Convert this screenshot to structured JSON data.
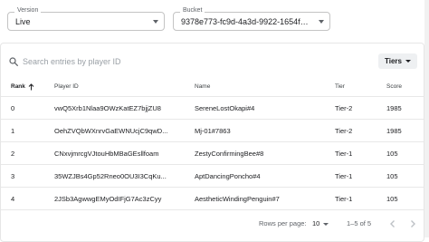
{
  "filters": {
    "version": {
      "label": "Version",
      "value": "Live"
    },
    "bucket": {
      "label": "Bucket",
      "value": "9378e773-fc9d-4a3d-9922-1654f6..."
    }
  },
  "search": {
    "placeholder": "Search entries by player ID",
    "value": ""
  },
  "tiers_button": {
    "label": "Tiers"
  },
  "table": {
    "columns": {
      "rank": "Rank",
      "player_id": "Player ID",
      "name": "Name",
      "tier": "Tier",
      "score": "Score"
    },
    "rows": [
      {
        "rank": "0",
        "player_id": "vwQ5Xrb1Nlaa9OWzKatEZ7bjjZU8",
        "name": "SereneLostOkapi#4",
        "tier": "Tier-2",
        "score": "1985"
      },
      {
        "rank": "1",
        "player_id": "OehZVQbWXnrvGaEWNUcjC9qwD...",
        "name": "Mj-01#7863",
        "tier": "Tier-2",
        "score": "1985"
      },
      {
        "rank": "2",
        "player_id": "CNxvjmrcgVJtouHbMBaGEsllfoam",
        "name": "ZestyConfirmingBee#8",
        "tier": "Tier-1",
        "score": "105"
      },
      {
        "rank": "3",
        "player_id": "35WZJBs4Gp52Rneo0OU3I3CqKu...",
        "name": "AptDancingPoncho#4",
        "tier": "Tier-1",
        "score": "105"
      },
      {
        "rank": "4",
        "player_id": "2JSb3AgwwgEMyOdIFjG7Ac3zCyy",
        "name": "AestheticWindingPenguin#7",
        "tier": "Tier-1",
        "score": "105"
      }
    ]
  },
  "pagination": {
    "rows_per_page_label": "Rows per page:",
    "rows_per_page": "10",
    "range": "1–5 of 5"
  }
}
